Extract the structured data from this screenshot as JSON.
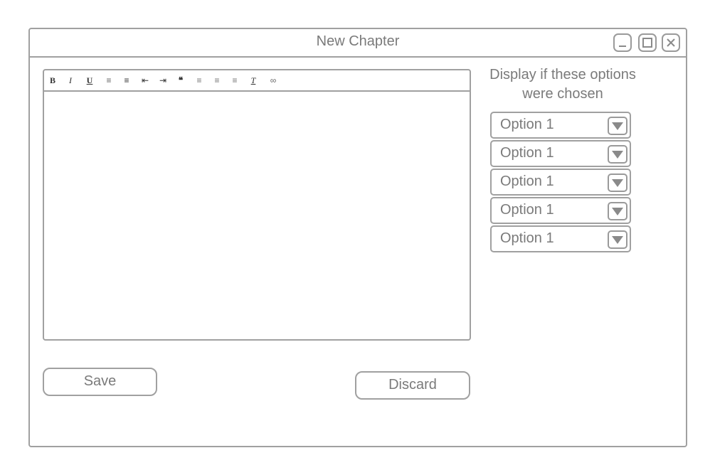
{
  "window": {
    "title": "New Chapter",
    "controls": [
      "minimize-icon",
      "maximize-icon",
      "close-icon"
    ]
  },
  "editor": {
    "toolbar": [
      {
        "name": "bold-icon",
        "glyph": "B"
      },
      {
        "name": "italic-icon",
        "glyph": "I"
      },
      {
        "name": "underline-icon",
        "glyph": "U"
      },
      {
        "name": "numbered-list-icon",
        "glyph": "≡"
      },
      {
        "name": "bulleted-list-icon",
        "glyph": "≡"
      },
      {
        "name": "outdent-icon",
        "glyph": "⇤"
      },
      {
        "name": "indent-icon",
        "glyph": "⇥"
      },
      {
        "name": "blockquote-icon",
        "glyph": "❝"
      },
      {
        "name": "align-left-icon",
        "glyph": "≡"
      },
      {
        "name": "align-center-icon",
        "glyph": "≡"
      },
      {
        "name": "align-right-icon",
        "glyph": "≡"
      },
      {
        "name": "clear-format-icon",
        "glyph": "T"
      },
      {
        "name": "link-icon",
        "glyph": "∞"
      }
    ],
    "content": ""
  },
  "options": {
    "label_line1": "Display if these options",
    "label_line2": "were chosen",
    "selects": [
      {
        "value": "Option 1"
      },
      {
        "value": "Option 1"
      },
      {
        "value": "Option 1"
      },
      {
        "value": "Option 1"
      },
      {
        "value": "Option 1"
      }
    ]
  },
  "actions": {
    "save_label": "Save",
    "discard_label": "Discard"
  },
  "colors": {
    "border": "#a0a0a0",
    "text": "#7a7a7a",
    "background": "#ffffff"
  }
}
